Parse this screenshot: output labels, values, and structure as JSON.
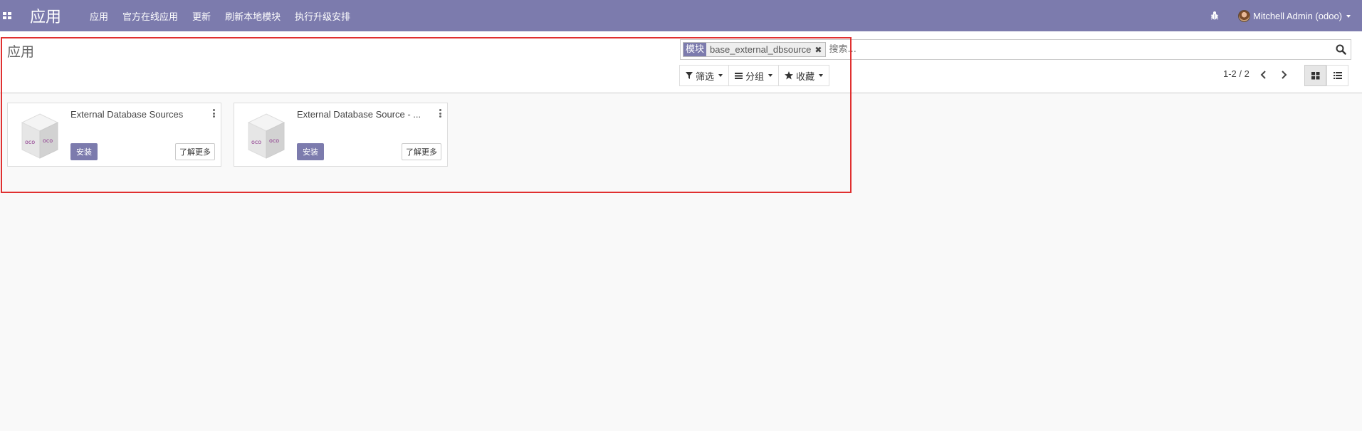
{
  "navbar": {
    "brand": "应用",
    "menu": [
      "应用",
      "官方在线应用",
      "更新",
      "刷新本地模块",
      "执行升级安排"
    ],
    "user": "Mitchell Admin (odoo)",
    "icons": [
      "apps-grid-icon",
      "bug-icon",
      "avatar"
    ]
  },
  "control_panel": {
    "title": "应用",
    "search": {
      "facet_category": "模块",
      "facet_value": "base_external_dbsource",
      "placeholder": "搜索..."
    },
    "buttons": {
      "filter": "筛选",
      "group": "分组",
      "favorite": "收藏"
    },
    "pager": "1-2 / 2"
  },
  "cards": [
    {
      "title": "External Database Sources",
      "install": "安装",
      "learn_more": "了解更多"
    },
    {
      "title": "External Database Source - ...",
      "install": "安装",
      "learn_more": "了解更多"
    }
  ],
  "colors": {
    "navbar": "#7c7bad",
    "highlight": "#e03030"
  }
}
